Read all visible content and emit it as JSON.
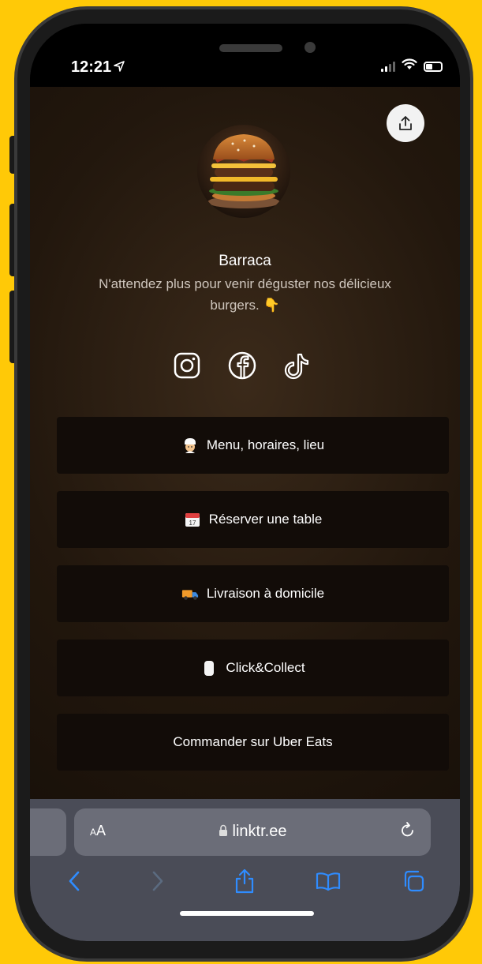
{
  "status_bar": {
    "time": "12:21",
    "location_arrow": "➶"
  },
  "profile": {
    "name": "Barraca",
    "bio": "N'attendez plus pour venir déguster nos délicieux burgers. 👇",
    "avatar_alt": "burger-photo"
  },
  "socials": [
    {
      "name": "instagram-icon"
    },
    {
      "name": "facebook-icon"
    },
    {
      "name": "tiktok-icon"
    }
  ],
  "links": [
    {
      "emoji": "👨‍🍳",
      "label": "Menu, horaires, lieu"
    },
    {
      "emoji": "📅",
      "label": "Réserver une table"
    },
    {
      "emoji": "🚚",
      "label": "Livraison à domicile"
    },
    {
      "emoji": "🥤",
      "label": "Click&Collect"
    },
    {
      "emoji": "",
      "label": "Commander sur Uber Eats"
    }
  ],
  "browser": {
    "aa_label": "AA",
    "url": "linktr.ee"
  },
  "colors": {
    "background": "#FFC907",
    "link_button_bg": "#120c08",
    "toolbar_bg": "#4a4c57",
    "nav_active": "#2f8cff",
    "nav_disabled": "#5b6b80"
  }
}
